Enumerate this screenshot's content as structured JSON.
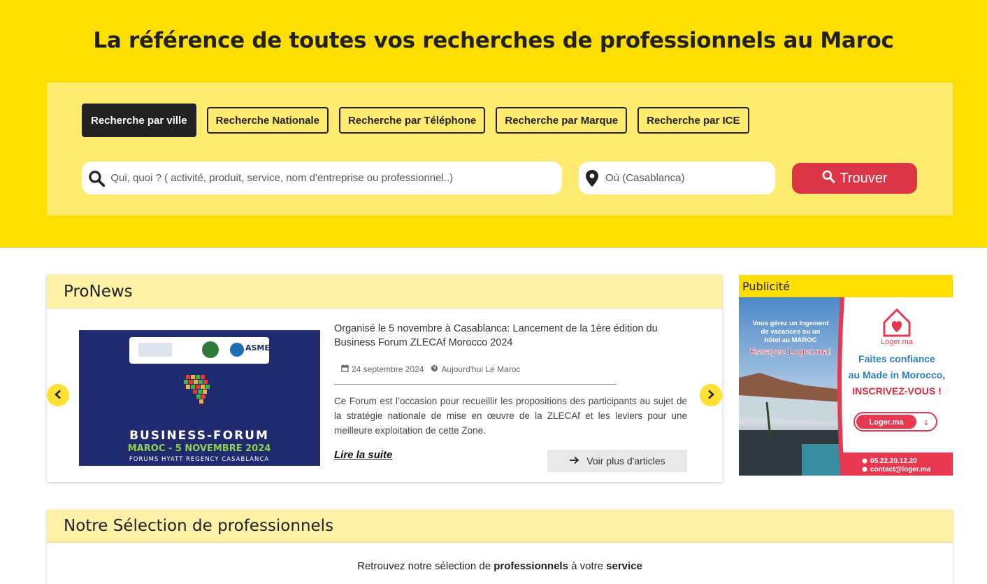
{
  "hero": {
    "title_parts": [
      "La ",
      "référence",
      " de toutes vos ",
      "recherches",
      " de ",
      "professionnels",
      " au ",
      "Maroc"
    ]
  },
  "tabs": [
    {
      "label": "Recherche par ville",
      "active": true
    },
    {
      "label": "Recherche Nationale",
      "active": false
    },
    {
      "label": "Recherche par Téléphone",
      "active": false
    },
    {
      "label": "Recherche par Marque",
      "active": false
    },
    {
      "label": "Recherche par ICE",
      "active": false
    }
  ],
  "search": {
    "what_placeholder": "Qui, quoi ? ( activité, produit, service, nom d'entreprise ou professionnel..)",
    "where_placeholder": "Où (Casablanca)",
    "button_label": "Trouver"
  },
  "pronews": {
    "heading": "ProNews",
    "article": {
      "title": "Organisé le 5 novembre à Casablanca: Lancement de la 1ère édition du Business Forum ZLECAf Morocco 2024",
      "date": "24 septembre 2024",
      "source": "Aujourd'hui Le Maroc",
      "excerpt": "Ce Forum est l’occasion pour recueillir les propositions des participants au sujet de la stratégie nationale de mise en œuvre de la ZLECAf et les leviers pour une meilleure exploitation de cette Zone.",
      "read_more": "Lire la suite",
      "image": {
        "logo_text": "ASMEX",
        "line1": "BUSINESS-FORUM",
        "line2": "MAROC - 5 NOVEMBRE 2024",
        "line3": "FORUMS HYATT REGENCY CASABLANCA"
      }
    },
    "more_articles": "Voir plus d'articles"
  },
  "ad": {
    "heading": "Publicité",
    "left_text": "Vous gérez un logement de vacances ou un hôtel au MAROC",
    "left_cta": "Essayez Loger.ma!",
    "brand": "Loger.ma",
    "tagline1": "Faites confiance",
    "tagline2": "au Made in Morocco,",
    "tagline3": "INSCRIVEZ-VOUS !",
    "button": "Loger.ma",
    "phone": "05.22.20.12.20",
    "email": "contact@loger.ma"
  },
  "selection": {
    "heading": "Notre Sélection de professionnels",
    "text_parts": [
      "Retrouvez notre sélection de ",
      "professionnels",
      " à votre ",
      "service"
    ]
  },
  "colors": {
    "brand_yellow": "#ffdf00",
    "panel_yellow": "#ffeb70",
    "find_red": "#dc3545"
  }
}
